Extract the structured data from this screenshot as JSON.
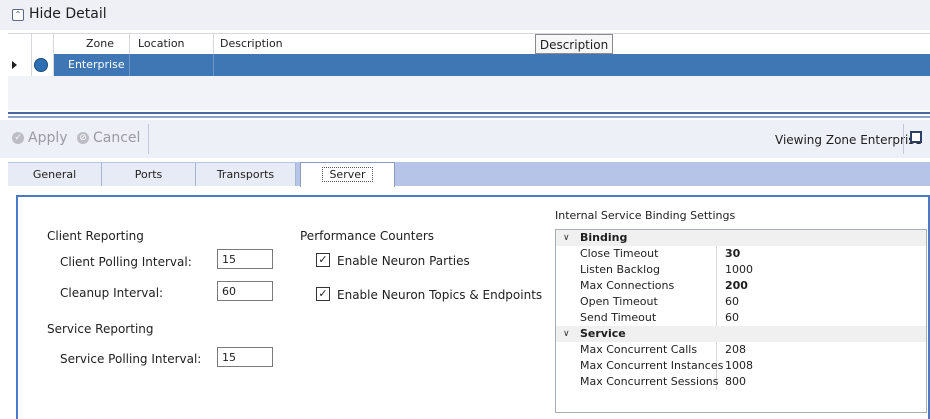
{
  "header": {
    "hide_detail": "Hide Detail"
  },
  "grid": {
    "columns": [
      "Zone",
      "Location",
      "Description"
    ],
    "rows": [
      {
        "zone": "Enterprise",
        "location": "",
        "description": ""
      }
    ],
    "tooltip": "Description"
  },
  "toolbar": {
    "apply": "Apply",
    "cancel": "Cancel",
    "viewing": "Viewing Zone Enterprise"
  },
  "tabs": [
    "General",
    "Ports",
    "Transports",
    "Server"
  ],
  "active_tab": "Server",
  "client_reporting": {
    "heading": "Client Reporting",
    "polling_label": "Client Polling Interval:",
    "polling_value": "15",
    "cleanup_label": "Cleanup Interval:",
    "cleanup_value": "60"
  },
  "service_reporting": {
    "heading": "Service Reporting",
    "polling_label": "Service Polling Interval:",
    "polling_value": "15"
  },
  "performance": {
    "heading": "Performance Counters",
    "parties": {
      "label": "Enable Neuron Parties",
      "checked": true
    },
    "topics": {
      "label": "Enable Neuron Topics & Endpoints",
      "checked": true
    }
  },
  "binding_settings": {
    "title": "Internal Service Binding Settings",
    "categories": [
      {
        "name": "Binding",
        "props": [
          {
            "name": "Close Timeout",
            "value": "30",
            "bold": true
          },
          {
            "name": "Listen Backlog",
            "value": "1000",
            "bold": false
          },
          {
            "name": "Max Connections",
            "value": "200",
            "bold": true
          },
          {
            "name": "Open Timeout",
            "value": "60",
            "bold": false
          },
          {
            "name": "Send Timeout",
            "value": "60",
            "bold": false
          }
        ]
      },
      {
        "name": "Service",
        "props": [
          {
            "name": "Max Concurrent Calls",
            "value": "208",
            "bold": false
          },
          {
            "name": "Max Concurrent Instances",
            "value": "1008",
            "bold": false
          },
          {
            "name": "Max Concurrent Sessions",
            "value": "800",
            "bold": false
          }
        ]
      }
    ]
  },
  "colors": {
    "accent": "#3f76b4",
    "panel_border": "#4a79c8",
    "tabbar": "#b6c4e8"
  },
  "icons": {
    "hide": "collapse-icon",
    "apply": "check-circle-icon",
    "cancel": "no-entry-icon",
    "row": "globe-icon"
  }
}
